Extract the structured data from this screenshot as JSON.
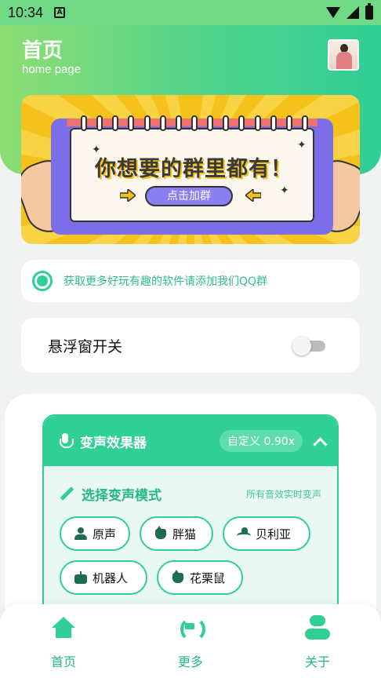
{
  "status_bar": {
    "time": "10:34",
    "notif_icon": "android-a-icon"
  },
  "header": {
    "title": "首页",
    "subtitle": "home page",
    "avatar": "user-avatar"
  },
  "banner": {
    "headline": "你想要的群里都有！",
    "button_label": "点击加群"
  },
  "notice": {
    "text": "获取更多好玩有趣的软件请添加我们QQ群"
  },
  "float_window": {
    "label": "悬浮窗开关",
    "enabled": false
  },
  "voice_panel": {
    "title": "变声效果器",
    "badge": "自定义 0.90x",
    "mode_title": "选择变声模式",
    "mode_hint": "所有音效实时变声",
    "modes": [
      {
        "label": "原声",
        "icon": "person-icon"
      },
      {
        "label": "胖猫",
        "icon": "cat-icon"
      },
      {
        "label": "贝利亚",
        "icon": "monster-icon"
      },
      {
        "label": "机器人",
        "icon": "robot-icon"
      },
      {
        "label": "花栗鼠",
        "icon": "squirrel-icon"
      }
    ]
  },
  "bottom_nav": {
    "items": [
      {
        "label": "首页",
        "icon": "home-icon"
      },
      {
        "label": "更多",
        "icon": "refresh-icon"
      },
      {
        "label": "关于",
        "icon": "user-icon"
      }
    ]
  },
  "colors": {
    "accent": "#2fcf96",
    "accent_dark": "#26b883",
    "header_start": "#8ddd72"
  }
}
